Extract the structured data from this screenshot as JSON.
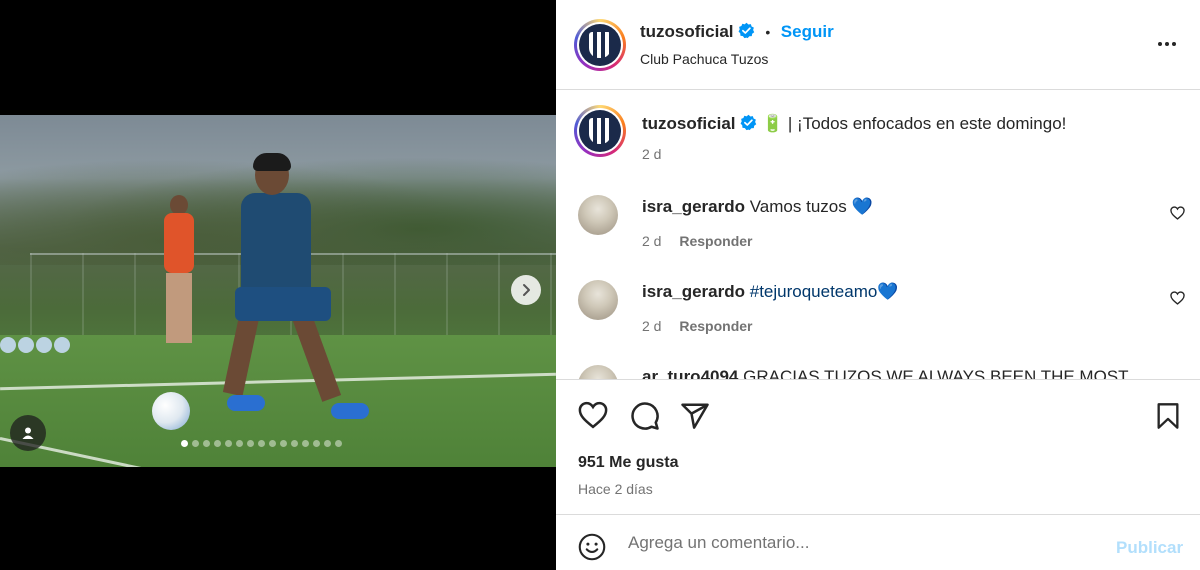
{
  "post": {
    "username": "tuzosoficial",
    "location": "Club Pachuca Tuzos",
    "follow_label": "Seguir",
    "separator": "•",
    "caption": "| ¡Todos enfocados en este domingo!",
    "caption_emoji": "🔋",
    "caption_time": "2 d",
    "carousel_total": 15,
    "carousel_index": 1
  },
  "comments": [
    {
      "username": "isra_gerardo",
      "text": "Vamos tuzos",
      "emoji": "💙",
      "time": "2 d",
      "reply": "Responder"
    },
    {
      "username": "isra_gerardo",
      "hashtag": "#tejuroqueteamo",
      "emoji": "💙",
      "time": "2 d",
      "reply": "Responder"
    },
    {
      "username": "ar_turo4094",
      "text": "GRACIAS TUZOS WE ALWAYS BEEN THE MOST"
    }
  ],
  "stats": {
    "likes": "951 Me gusta",
    "ago": "Hace 2 días"
  },
  "composer": {
    "placeholder": "Agrega un comentario...",
    "post_label": "Publicar"
  },
  "colors": {
    "accent": "#0095f6",
    "verified": "#0095f6",
    "post_disabled": "#b2dffc",
    "heart_emoji": "#3b6ee8"
  },
  "icons": [
    "chevron-right-icon",
    "user-tag-icon",
    "more-icon",
    "verified-icon",
    "heart-icon",
    "comment-icon",
    "share-icon",
    "bookmark-icon",
    "emoji-icon"
  ]
}
